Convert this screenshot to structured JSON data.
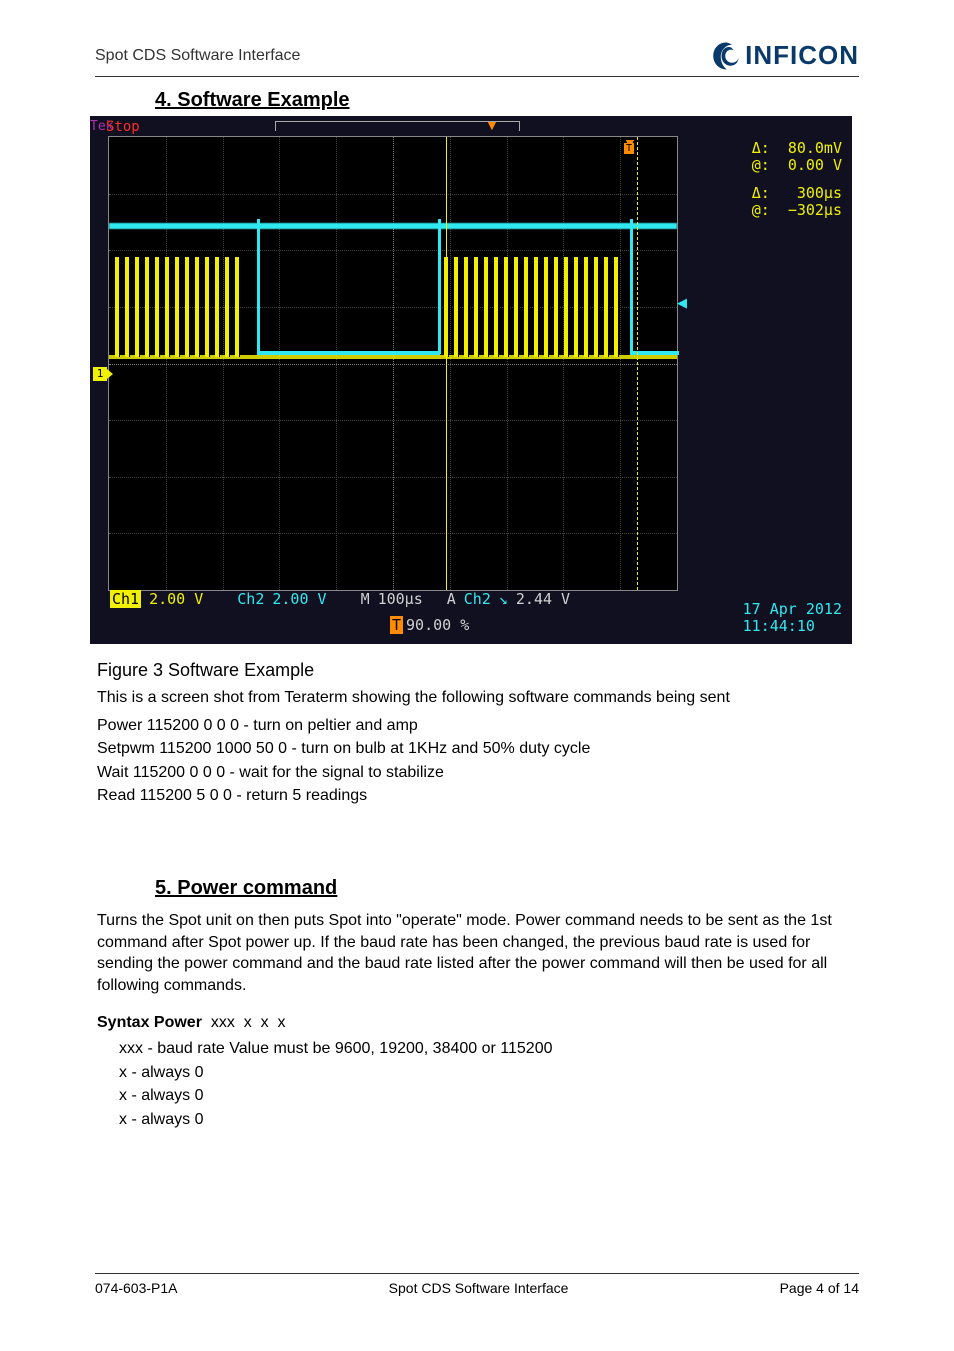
{
  "header": {
    "doc_title": "Spot CDS Software Interface",
    "brand": "INFICON"
  },
  "section4": {
    "title": "4. Software Example",
    "figure_label": "Figure 3 Software Example",
    "intro": "This is a screen shot from Teraterm showing the following software commands being sent",
    "commands": [
      "Power       115200   0          0       0  -  turn on peltier and amp",
      "Setpwm    115200   1000    50     0   -  turn on  bulb at 1KHz and 50% duty cycle",
      "Wait          115200   0           0      0   -  wait  for  the signal to stabilize",
      "Read         115200   5           0      0   -  return 5  readings"
    ]
  },
  "section5": {
    "title": "5. Power command",
    "p1": "Turns the Spot unit on then puts Spot into \"operate\" mode. Power command needs to be sent as the 1st command after Spot power up. If the baud rate has been changed, the previous baud rate is used for sending the power command and the baud rate listed after the power command will then be used for all following commands.",
    "p2_label": "Syntax Power",
    "p2_rest": "  xxx  x  x  x",
    "list": [
      "xxx  - baud rate Value must be 9600, 19200, 38400 or 115200",
      "x      - always 0",
      "x      - always 0",
      "x      - always 0"
    ]
  },
  "scope": {
    "tek": "Tek",
    "stop": "Stop",
    "ch1_lbl": "Ch1",
    "ch1_val": "2.00 V",
    "ch2_lbl": "Ch2",
    "ch2_val": "2.00 V",
    "h_lbl": "M",
    "h_val": "100µs",
    "a_lbl": "A",
    "a_ch": "Ch2",
    "a_edge": "↘",
    "a_val": "2.44 V",
    "pct_t": "T",
    "pct": "90.00 %",
    "d1a": "Δ:",
    "d1b": "80.0mV",
    "d2a": "@:",
    "d2b": "0.00 V",
    "d3a": "Δ:",
    "d3b": "300µs",
    "d4a": "@:",
    "d4b": "−302µs",
    "date": "17 Apr 2012",
    "time": "11:44:10",
    "marker1": "1",
    "markerT": "T"
  },
  "footer": {
    "left": "074-603-P1A",
    "center": "Spot CDS Software Interface",
    "right": "Page 4 of 14"
  }
}
